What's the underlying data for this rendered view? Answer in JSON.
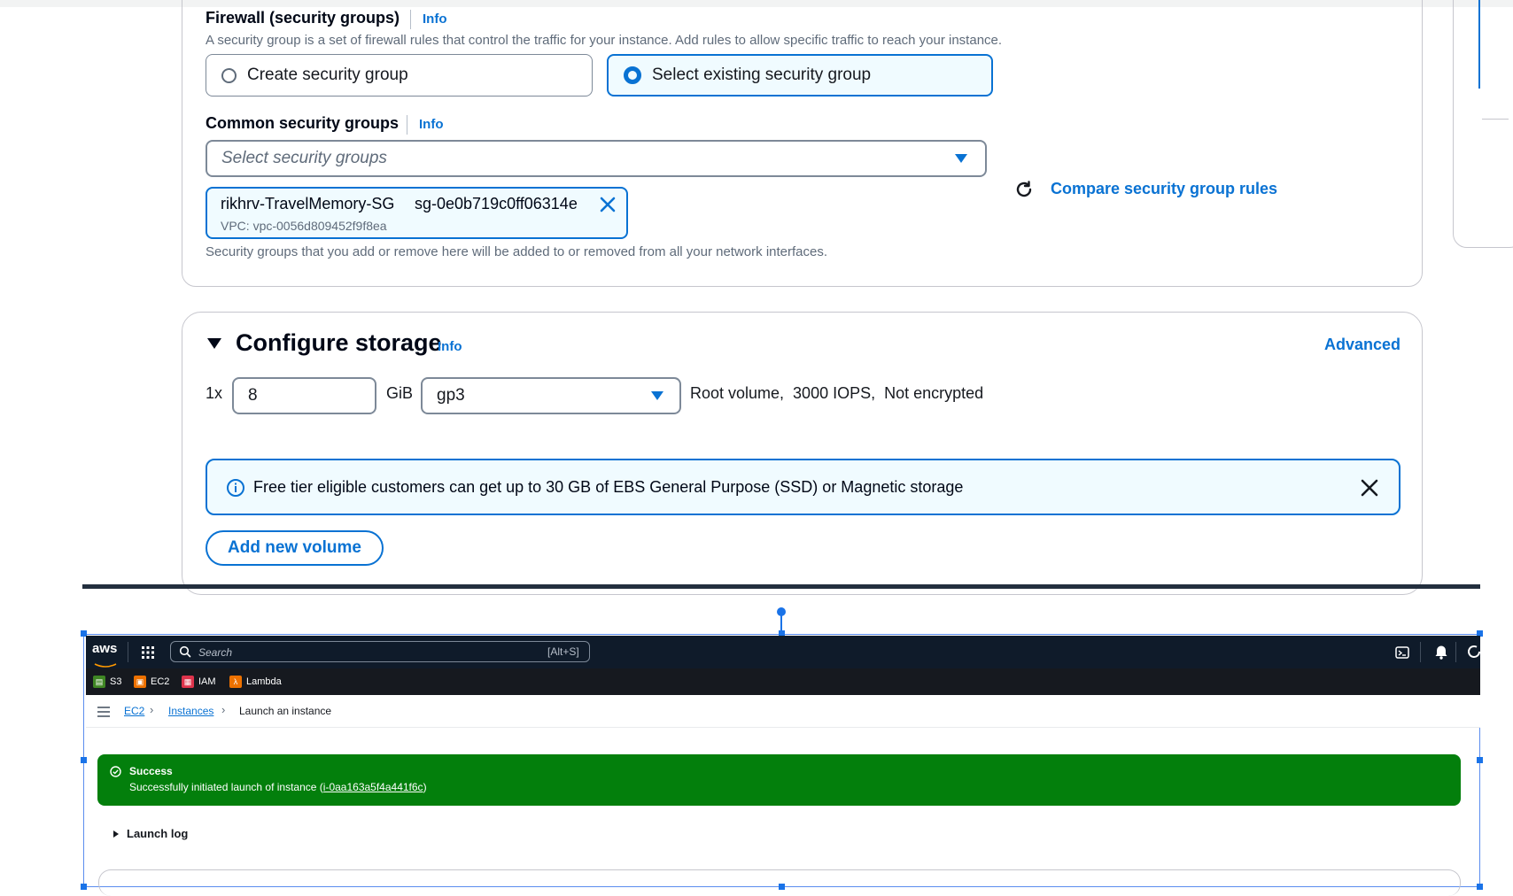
{
  "firewall": {
    "title": "Firewall (security groups)",
    "info": "Info",
    "description": "A security group is a set of firewall rules that control the traffic for your instance. Add rules to allow specific traffic to reach your instance.",
    "option_create": "Create security group",
    "option_select_existing": "Select existing security group",
    "selected_option": "Select existing security group"
  },
  "common_sg": {
    "title": "Common security groups",
    "info": "Info",
    "placeholder": "Select security groups",
    "compare_link": "Compare security group rules",
    "token": {
      "name": "rikhrv-TravelMemory-SG",
      "id": "sg-0e0b719c0ff06314e",
      "vpc": "VPC: vpc-0056d809452f9f8ea"
    },
    "hint": "Security groups that you add or remove here will be added to or removed from all your network interfaces."
  },
  "storage": {
    "title": "Configure storage",
    "info": "Info",
    "advanced": "Advanced",
    "count_label": "1x",
    "size_value": "8",
    "unit": "GiB",
    "volume_type": "gp3",
    "volume_desc": "Root volume,  3000 IOPS,  Not encrypted",
    "free_tier_notice": "Free tier eligible customers can get up to 30 GB of EBS General Purpose (SSD) or Magnetic storage",
    "add_volume": "Add new volume"
  },
  "console": {
    "logo": "aws",
    "search_placeholder": "Search",
    "search_shortcut": "[Alt+S]",
    "favorites": [
      {
        "label": "S3",
        "color": "#3f8624"
      },
      {
        "label": "EC2",
        "color": "#ed7100"
      },
      {
        "label": "IAM",
        "color": "#dd344c"
      },
      {
        "label": "Lambda",
        "color": "#ed7100"
      }
    ],
    "breadcrumb": {
      "ec2": "EC2",
      "instances": "Instances",
      "current": "Launch an instance"
    },
    "success": {
      "title": "Success",
      "message_prefix": "Successfully initiated launch of instance (",
      "instance_id": "i-0aa163a5f4a441f6c",
      "message_suffix": ")"
    },
    "launch_log": "Launch log"
  },
  "colors": {
    "accent": "#0972d3",
    "success": "#037f0c",
    "nav_dark": "#0f1b2a"
  }
}
